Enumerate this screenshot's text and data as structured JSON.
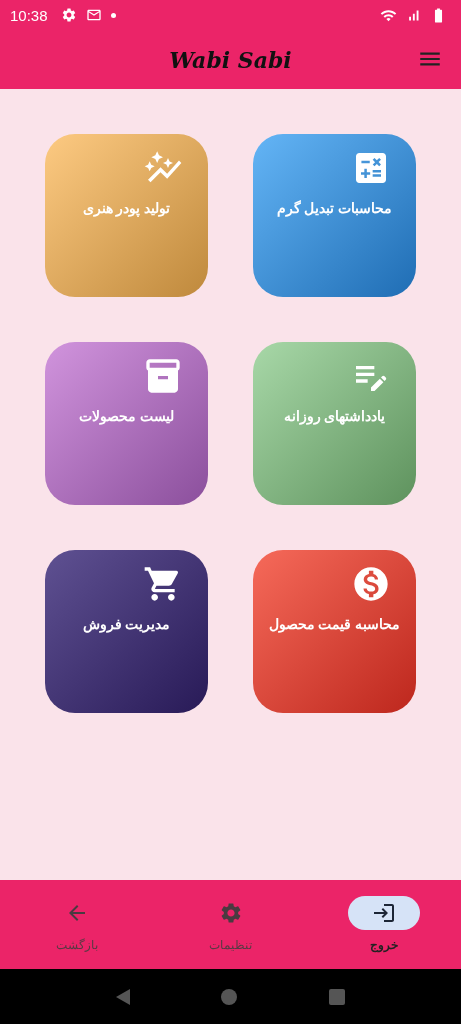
{
  "status_bar": {
    "time": "10:38"
  },
  "app_bar": {
    "title": "Wabi Sabi"
  },
  "cards": [
    {
      "kind": "calculator",
      "label": "محاسبات تبدیل گرم"
    },
    {
      "kind": "sparkle",
      "label": "تولید پودر هنری"
    },
    {
      "kind": "notes",
      "label": "یادداشتهای روزانه"
    },
    {
      "kind": "archive",
      "label": "لیست محصولات"
    },
    {
      "kind": "price",
      "label": "محاسبه قیمت محصول"
    },
    {
      "kind": "cart",
      "label": "مدیریت فروش"
    }
  ],
  "bottom_nav": [
    {
      "kind": "exit",
      "label": "خروج",
      "selected": true
    },
    {
      "kind": "settings",
      "label": "تنظیمات",
      "selected": false
    },
    {
      "kind": "back",
      "label": "بازگشت",
      "selected": false
    }
  ]
}
